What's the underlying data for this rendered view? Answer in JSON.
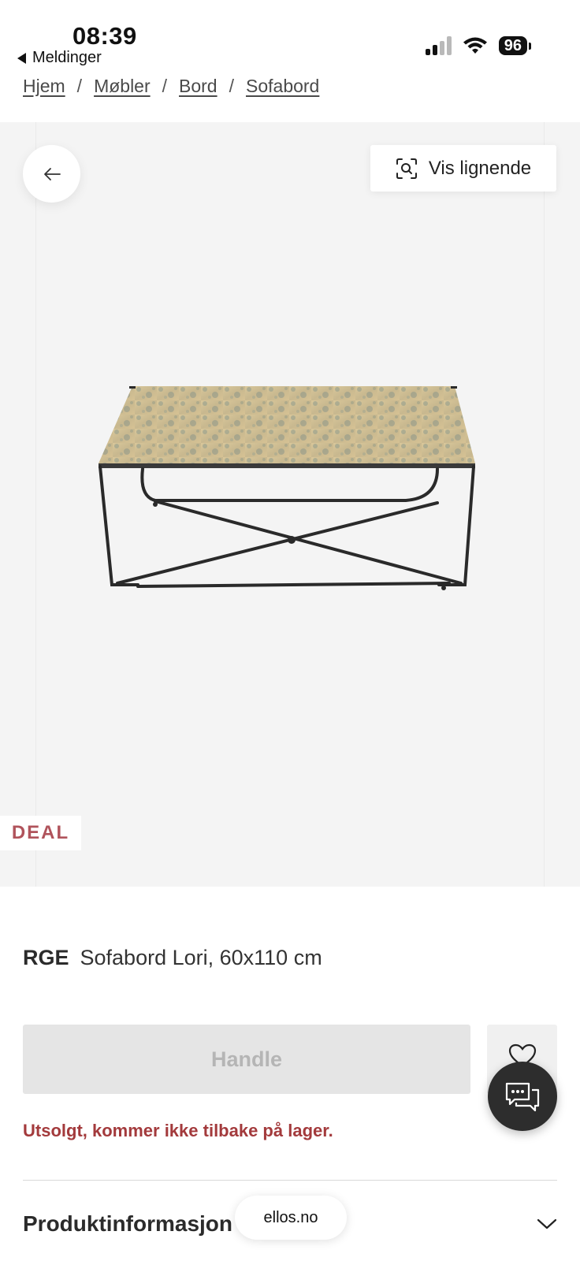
{
  "status_bar": {
    "time": "08:39",
    "back_app": "Meldinger",
    "battery": "96"
  },
  "breadcrumb": {
    "items": [
      "Hjem",
      "Møbler",
      "Bord",
      "Sofabord"
    ],
    "separator": "/"
  },
  "gallery": {
    "similar_label": "Vis lignende",
    "badge": "DEAL"
  },
  "product": {
    "brand": "RGE",
    "name": "Sofabord Lori, 60x110 cm",
    "buy_label": "Handle",
    "stock_message": "Utsolgt, kommer ikke tilbake på lager.",
    "info_label": "Produktinformasjon"
  },
  "browser": {
    "url": "ellos.no"
  },
  "colors": {
    "deal_badge": "#b0535b",
    "stock_message": "#a33a3c",
    "buy_disabled_bg": "#e5e5e5",
    "chat_button": "#2d2d2d"
  },
  "icons": [
    "arrow-left-icon",
    "visual-search-icon",
    "heart-icon",
    "chat-icon",
    "chevron-down-icon",
    "wifi-icon",
    "signal-icon",
    "battery-icon"
  ]
}
